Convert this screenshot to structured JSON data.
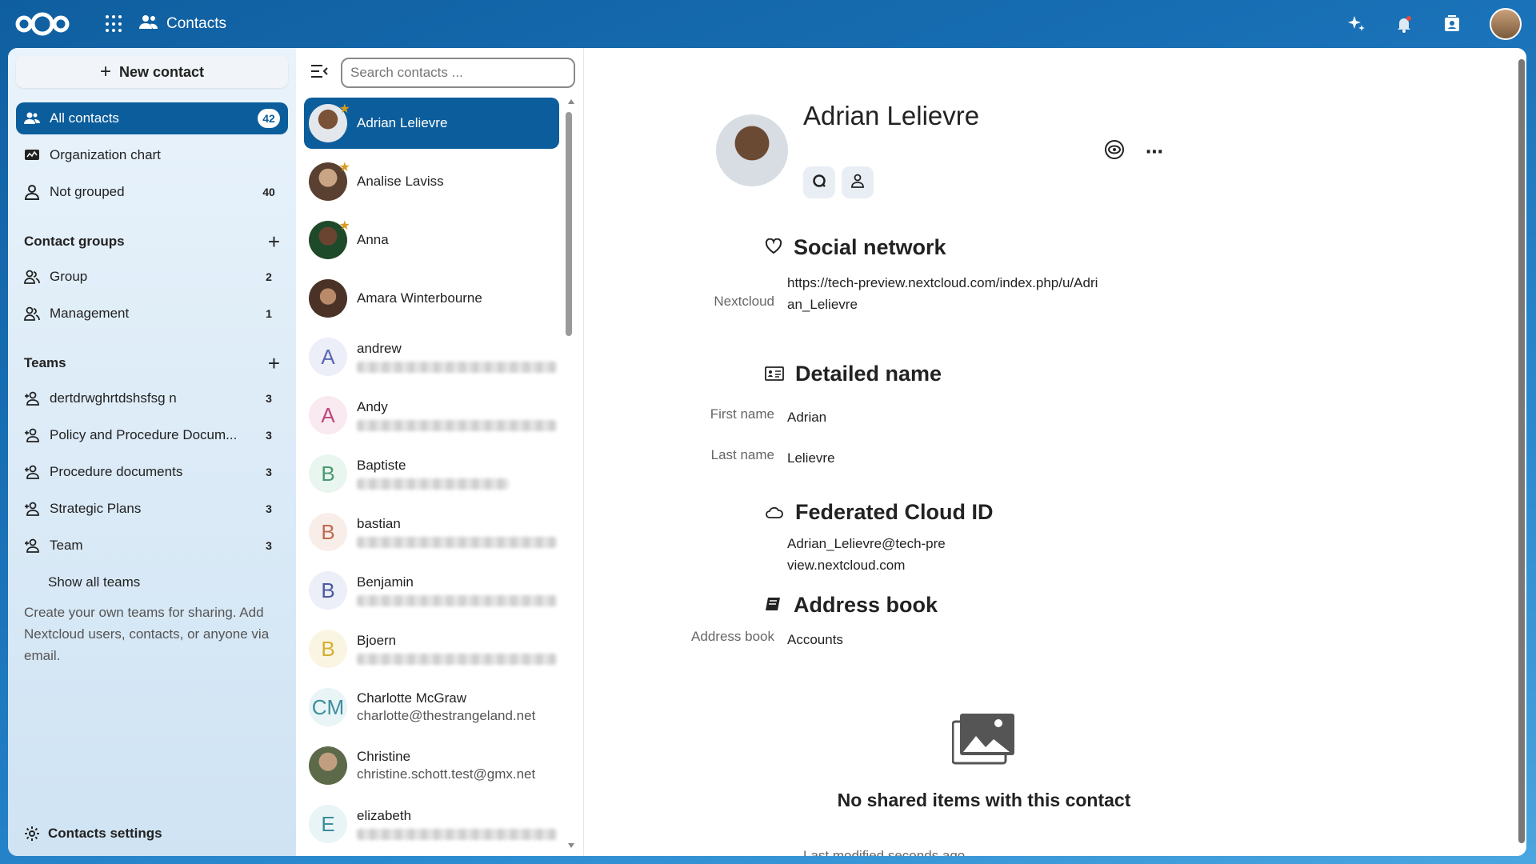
{
  "header": {
    "app_name": "Contacts"
  },
  "nav": {
    "new_contact": "New contact",
    "items": [
      {
        "label": "All contacts",
        "count": "42"
      },
      {
        "label": "Organization chart",
        "count": ""
      },
      {
        "label": "Not grouped",
        "count": "40"
      }
    ],
    "groups_title": "Contact groups",
    "groups": [
      {
        "label": "Group",
        "count": "2"
      },
      {
        "label": "Management",
        "count": "1"
      }
    ],
    "teams_title": "Teams",
    "teams": [
      {
        "label": "dertdrwghrtdshsfsg n",
        "count": "3"
      },
      {
        "label": "Policy and Procedure Docum...",
        "count": "3"
      },
      {
        "label": "Procedure documents",
        "count": "3"
      },
      {
        "label": "Strategic Plans",
        "count": "3"
      },
      {
        "label": "Team",
        "count": "3"
      }
    ],
    "show_all_teams": "Show all teams",
    "hint": "Create your own teams for sharing. Add Nextcloud users, contacts, or anyone via email.",
    "settings": "Contacts settings"
  },
  "list": {
    "search_placeholder": "Search contacts ...",
    "contacts": [
      {
        "name": "Adrian Lelievre",
        "initial": "",
        "email": "",
        "favorite": true
      },
      {
        "name": "Analise Laviss",
        "initial": "",
        "email": "",
        "favorite": true
      },
      {
        "name": "Anna",
        "initial": "",
        "email": "",
        "favorite": true
      },
      {
        "name": "Amara Winterbourne",
        "initial": "",
        "email": "",
        "favorite": false
      },
      {
        "name": "andrew",
        "initial": "A",
        "email": "",
        "favorite": false
      },
      {
        "name": "Andy",
        "initial": "A",
        "email": "",
        "favorite": false
      },
      {
        "name": "Baptiste",
        "initial": "B",
        "email": "",
        "favorite": false
      },
      {
        "name": "bastian",
        "initial": "B",
        "email": "",
        "favorite": false
      },
      {
        "name": "Benjamin",
        "initial": "B",
        "email": "",
        "favorite": false
      },
      {
        "name": "Bjoern",
        "initial": "B",
        "email": "",
        "favorite": false
      },
      {
        "name": "Charlotte McGraw",
        "initial": "CM",
        "email": "charlotte@thestrangeland.net",
        "favorite": false
      },
      {
        "name": "Christine",
        "initial": "",
        "email": "christine.schott.test@gmx.net",
        "favorite": false
      },
      {
        "name": "elizabeth",
        "initial": "E",
        "email": "",
        "favorite": false
      }
    ]
  },
  "detail": {
    "name": "Adrian Lelievre",
    "more": "⋯",
    "social_title": "Social network",
    "social_key": "Nextcloud",
    "social_value": "https://tech-preview.nextcloud.com/index.php/u/Adrian_Lelievre",
    "detailed_title": "Detailed name",
    "first_name_key": "First name",
    "first_name": "Adrian",
    "last_name_key": "Last name",
    "last_name": "Lelievre",
    "cloud_title": "Federated Cloud ID",
    "cloud_value": "Adrian_Lelievre@tech-preview.nextcloud.com",
    "book_title": "Address book",
    "book_key": "Address book",
    "book_value": "Accounts",
    "empty_title": "No shared items with this contact",
    "last_modified": "Last modified seconds ago"
  }
}
